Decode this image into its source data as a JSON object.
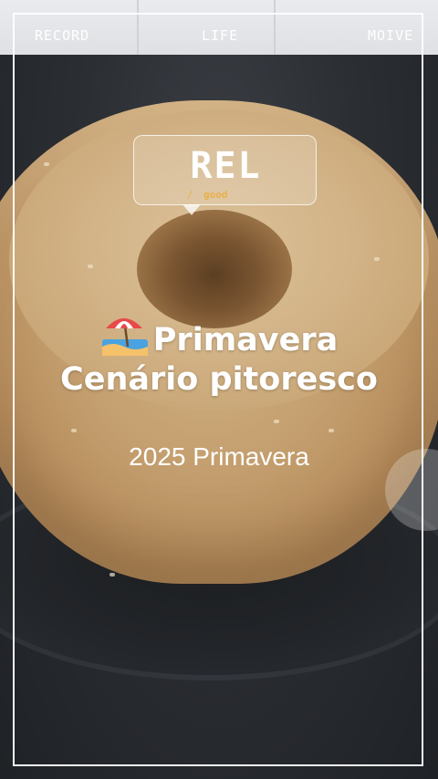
{
  "nav": {
    "left": "RECORD",
    "center": "LIFE",
    "right": "MOIVE"
  },
  "sticker": {
    "title": "REL",
    "slash": "/",
    "subtitle": "good"
  },
  "headline": {
    "line1": "Primavera",
    "line2": "Cenário pitoresco",
    "icon": "beach-umbrella-icon"
  },
  "subtitle": "2025 Primavera",
  "colors": {
    "text": "#ffffff",
    "accent": "#e8b14a"
  }
}
